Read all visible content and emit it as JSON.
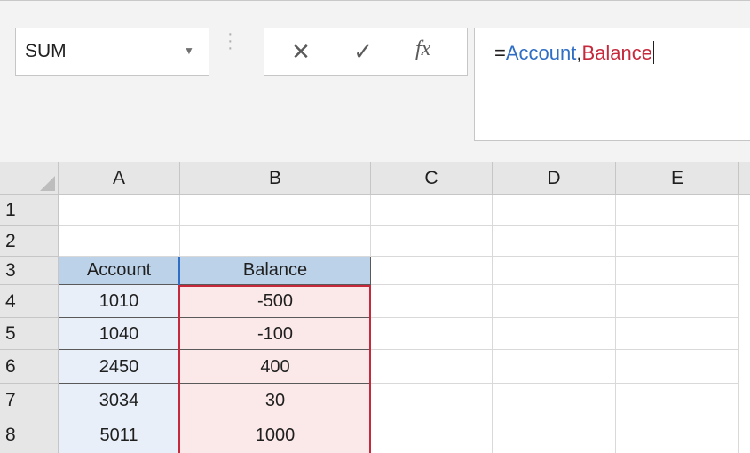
{
  "name_box": {
    "value": "SUM",
    "dropdown_icon": "chevron-down-icon"
  },
  "formula_bar": {
    "cancel_icon": "close-icon",
    "enter_icon": "checkmark-icon",
    "fx_label": "fx",
    "formula": {
      "equals": "=",
      "ref1": "Account",
      "comma": ",",
      "ref2": "Balance"
    }
  },
  "grid": {
    "columns": [
      "A",
      "B",
      "C",
      "D",
      "E"
    ],
    "rows": [
      "1",
      "2",
      "3",
      "4",
      "5",
      "6",
      "7",
      "8"
    ],
    "headers": {
      "A3": "Account",
      "B3": "Balance"
    },
    "data": [
      {
        "row": "4",
        "account": "1010",
        "balance": "-500"
      },
      {
        "row": "5",
        "account": "1040",
        "balance": "-100"
      },
      {
        "row": "6",
        "account": "2450",
        "balance": "400"
      },
      {
        "row": "7",
        "account": "3034",
        "balance": "30"
      },
      {
        "row": "8",
        "account": "5011",
        "balance": "1000"
      }
    ]
  },
  "colors": {
    "account_ref": "#2f6ec4",
    "balance_ref": "#c6283c",
    "account_fill": "#e8eff8",
    "balance_fill": "#fbe8e8",
    "header_fill": "#bcd2e9"
  }
}
